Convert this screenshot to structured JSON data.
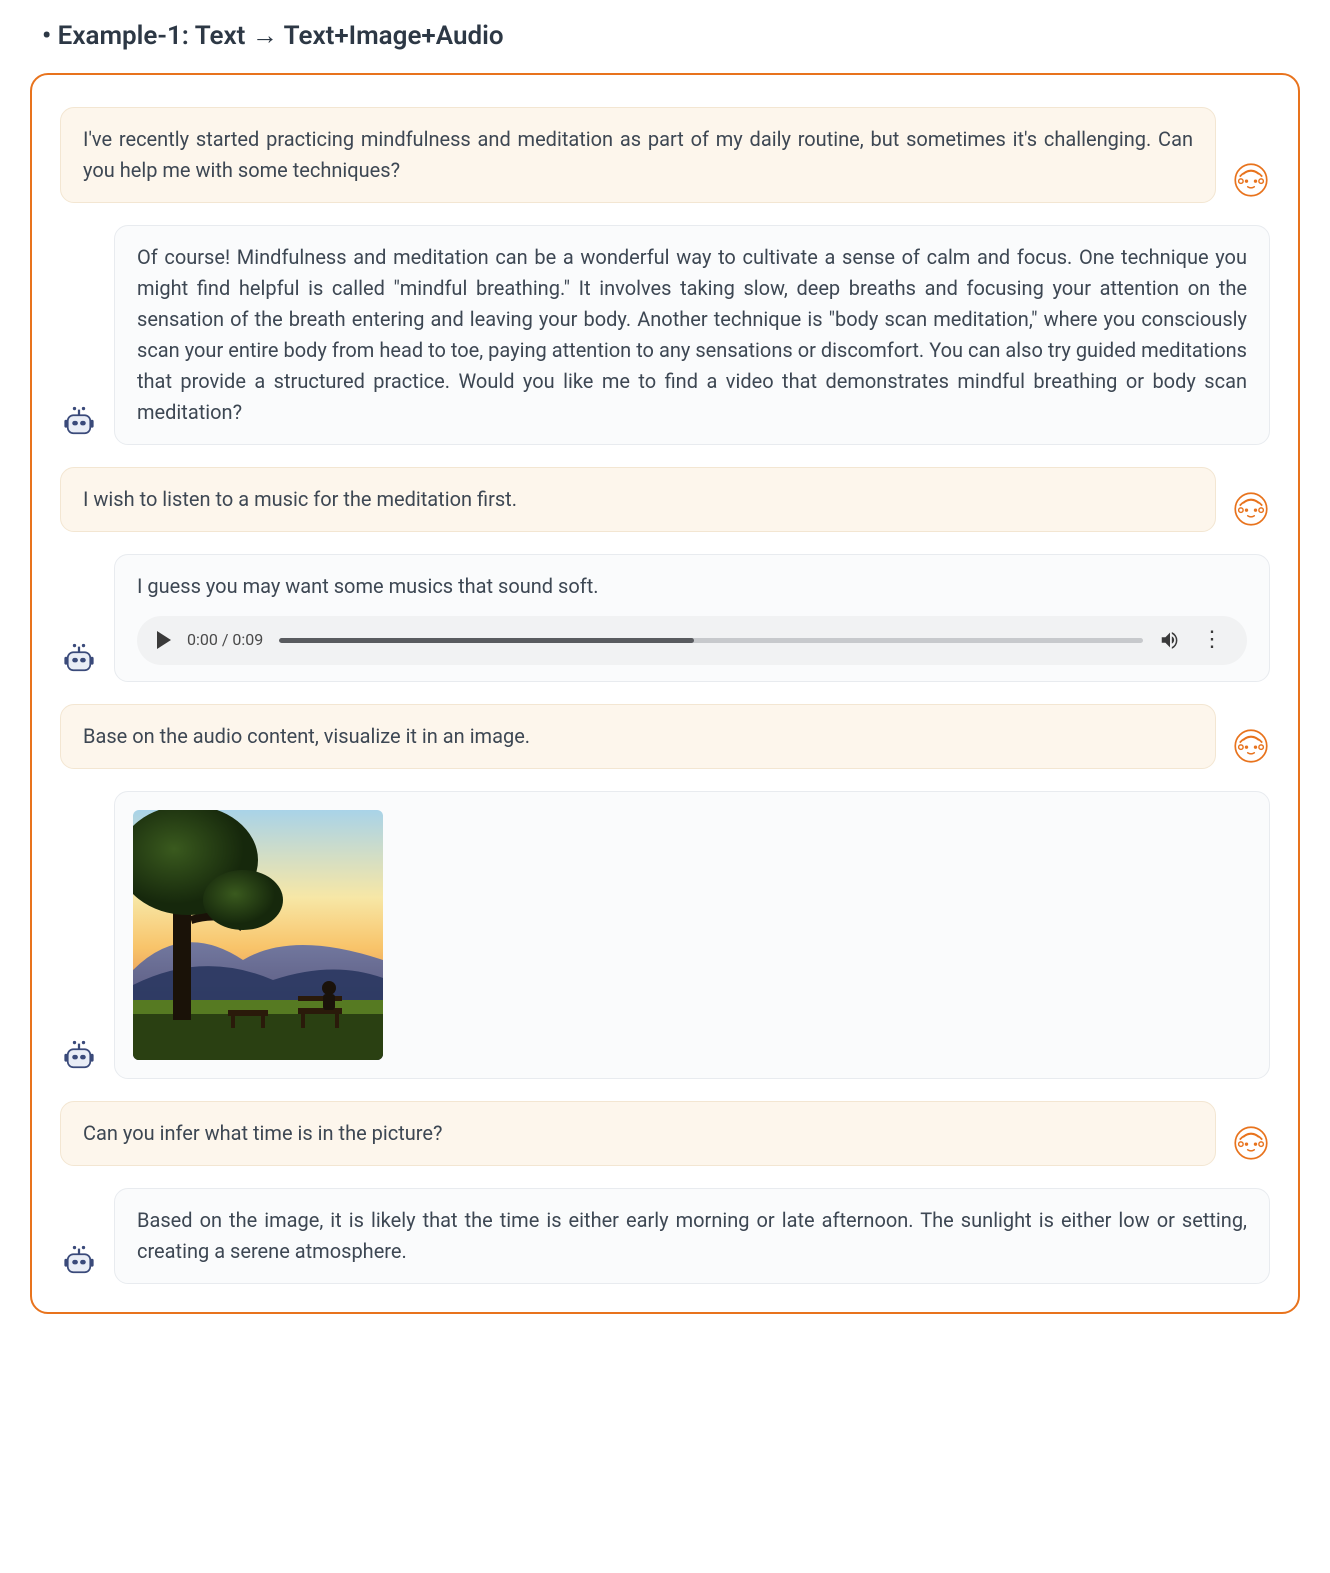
{
  "title": "• Example-1: Text → Text+Image+Audio",
  "messages": {
    "u1": "I've recently started practicing mindfulness and meditation as part of my daily routine, but sometimes it's challenging. Can you help me with some techniques?",
    "b1": "Of course! Mindfulness and meditation can be a wonderful way to cultivate a sense of calm and focus. One technique you might find helpful is called \"mindful breathing.\" It involves taking slow, deep breaths and focusing your attention on the sensation of the breath entering and leaving your body. Another technique is \"body scan meditation,\" where you consciously scan your entire body from head to toe, paying attention to any sensations or discomfort. You can also try guided meditations that provide a structured practice. Would you like me to find a video that demonstrates mindful breathing or body scan meditation?",
    "u2": "I wish to listen to a music for the meditation first.",
    "b2_text": "I guess you may want some musics that sound soft.",
    "u3": "Base on the audio content, visualize it in an image.",
    "u4": "Can you infer what time is in the picture?",
    "b4": "Based on the image, it is likely that the time is either early morning or late afternoon. The sunlight is either low or setting, creating a serene atmosphere."
  },
  "audio": {
    "current": "0:00",
    "duration": "0:09"
  },
  "icons": {
    "user": "user-avatar-icon",
    "bot": "bot-avatar-icon",
    "play": "play-icon",
    "volume": "volume-icon",
    "more": "more-vert-icon"
  }
}
